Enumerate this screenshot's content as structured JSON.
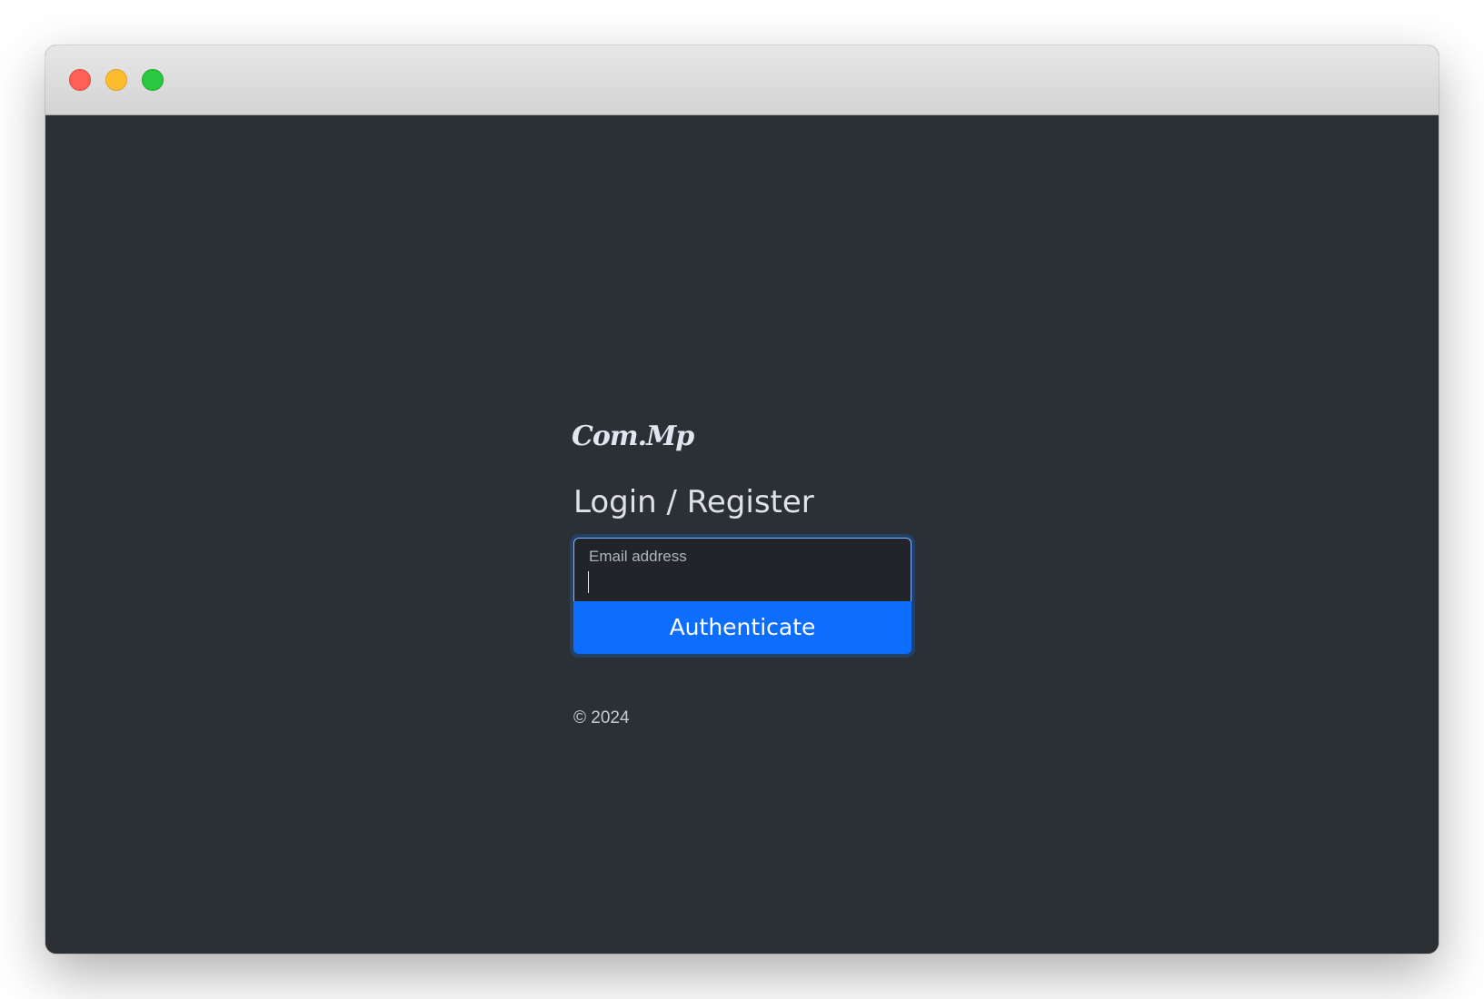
{
  "window": {
    "controls": [
      "close",
      "minimize",
      "maximize"
    ]
  },
  "brand": {
    "logo_text": "Com.Mp"
  },
  "form": {
    "title": "Login / Register",
    "email_label": "Email address",
    "email_value": "",
    "submit_label": "Authenticate"
  },
  "footer": {
    "copyright": "© 2024"
  },
  "colors": {
    "background": "#2b3035",
    "primary": "#0d6efd",
    "input_background": "#212529",
    "focus_border": "#86b7fe"
  }
}
